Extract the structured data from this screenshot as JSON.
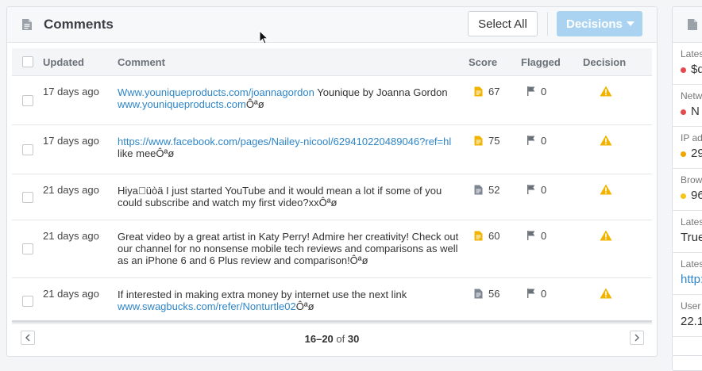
{
  "panel": {
    "title": "Comments",
    "select_all_label": "Select All",
    "decisions_label": "Decisions"
  },
  "table": {
    "columns": [
      "Updated",
      "Comment",
      "Score",
      "Flagged",
      "Decision"
    ],
    "rows": [
      {
        "updated": "17 days ago",
        "comment_parts": [
          {
            "text": "Www.youniqueproducts.com/joannagordon",
            "link": true
          },
          {
            "text": " Younique by Joanna Gordon ",
            "link": false
          },
          {
            "text": "www.youniqueproducts.com",
            "link": true
          },
          {
            "text": "Ôªø",
            "link": false
          }
        ],
        "score": "67",
        "score_icon": "doc-icon-yellow",
        "flagged": "0",
        "decision_icon": "warning-icon"
      },
      {
        "updated": "17 days ago",
        "comment_parts": [
          {
            "text": "https://www.facebook.com/pages/Nailey-nicool/629410220489046?ref=hl",
            "link": true
          },
          {
            "text": " like meeÔªø",
            "link": false
          }
        ],
        "score": "75",
        "score_icon": "doc-icon-yellow",
        "flagged": "0",
        "decision_icon": "warning-icon"
      },
      {
        "updated": "21 days ago",
        "comment_parts": [
          {
            "text": "Hiyaüòä I just started YouTube and it would mean a lot if some of you could subscribe and watch my first video?xxÔªø",
            "link": false
          }
        ],
        "score": "52",
        "score_icon": "doc-icon-gray",
        "flagged": "0",
        "decision_icon": "warning-icon"
      },
      {
        "updated": "21 days ago",
        "comment_parts": [
          {
            "text": "Great video by a great artist in Katy Perry! Admire her creativity! Check out our channel for no nonsense mobile tech reviews and comparisons as well as an iPhone 6 and 6 Plus review and comparison!Ôªø",
            "link": false
          }
        ],
        "score": "60",
        "score_icon": "doc-icon-yellow",
        "flagged": "0",
        "decision_icon": "warning-icon"
      },
      {
        "updated": "21 days ago",
        "comment_parts": [
          {
            "text": "If interested in making extra money by internet use the next link ",
            "link": false
          },
          {
            "text": "www.swagbucks.com/refer/Nonturtle02",
            "link": true
          },
          {
            "text": "Ôªø",
            "link": false
          }
        ],
        "score": "56",
        "score_icon": "doc-icon-gray",
        "flagged": "0",
        "decision_icon": "warning-icon"
      }
    ]
  },
  "pagination": {
    "range": "16–20",
    "of_label": "of",
    "total": "30"
  },
  "side_panel": {
    "items": [
      {
        "label": "Lates",
        "value": "$d",
        "dot_color": "#e5484d",
        "link": false
      },
      {
        "label": "Netw",
        "value": "N",
        "dot_color": "#e5484d",
        "link": false
      },
      {
        "label": "IP ad",
        "value": "29",
        "dot_color": "#f0a400",
        "link": false
      },
      {
        "label": "Brow",
        "value": "96",
        "dot_color": "#f5c518",
        "link": false
      },
      {
        "label": "Lates",
        "value": "True",
        "dot_color": "",
        "link": false
      },
      {
        "label": "Lates",
        "value": "http:",
        "dot_color": "",
        "link": true
      },
      {
        "label": "User",
        "value": "22.1",
        "dot_color": "",
        "link": false
      }
    ]
  },
  "colors": {
    "link": "#2e86c8",
    "warning": "#f0b400",
    "doc_yellow": "#f0b400",
    "doc_gray": "#7d8690",
    "decisions_button": "#a9d3f0"
  }
}
